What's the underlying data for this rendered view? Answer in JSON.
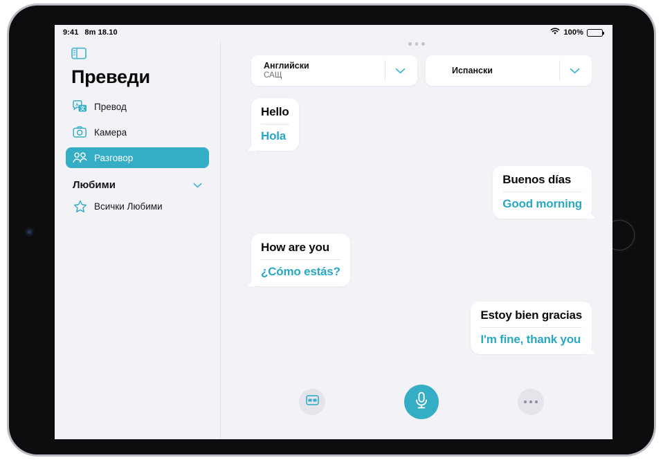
{
  "status_bar": {
    "time": "9:41",
    "date": "8m 18.10",
    "wifi_icon": "wifi-icon",
    "battery_percent": "100%",
    "battery_icon": "battery-full-icon"
  },
  "sidebar": {
    "toggle_icon": "sidebar-toggle-icon",
    "title": "Преведи",
    "items": [
      {
        "label": "Превод",
        "icon": "translate-icon",
        "selected": false
      },
      {
        "label": "Камера",
        "icon": "camera-icon",
        "selected": false
      },
      {
        "label": "Разговор",
        "icon": "conversation-people-icon",
        "selected": true
      }
    ],
    "section": {
      "label": "Любими",
      "chevron_icon": "chevron-down-icon"
    },
    "favorites": [
      {
        "label": "Всички Любими",
        "icon": "star-icon"
      }
    ]
  },
  "main": {
    "grabber_icon": "window-grabber-dots",
    "language_from": {
      "name": "Английски",
      "region": "САЩ",
      "chevron_icon": "chevron-down-icon"
    },
    "language_to": {
      "name": "Испански",
      "region": "",
      "chevron_icon": "chevron-down-icon"
    },
    "messages": [
      {
        "side": "left",
        "source": "Hello",
        "translation": "Hola"
      },
      {
        "side": "right",
        "source": "Buenos días",
        "translation": "Good morning"
      },
      {
        "side": "left",
        "source": "How are you",
        "translation": "¿Cómo estás?"
      },
      {
        "side": "right",
        "source": "Estoy bien gracias",
        "translation": "I'm fine, thank you"
      }
    ],
    "toolbar": {
      "side_by_side_icon": "side-by-side-view-icon",
      "mic_icon": "microphone-icon",
      "more_icon": "more-options-icon"
    }
  },
  "colors": {
    "accent": "#35adc4",
    "translation_text": "#2ba7c2",
    "screen_background": "#f2f2f7",
    "bubble_background": "#ffffff"
  }
}
